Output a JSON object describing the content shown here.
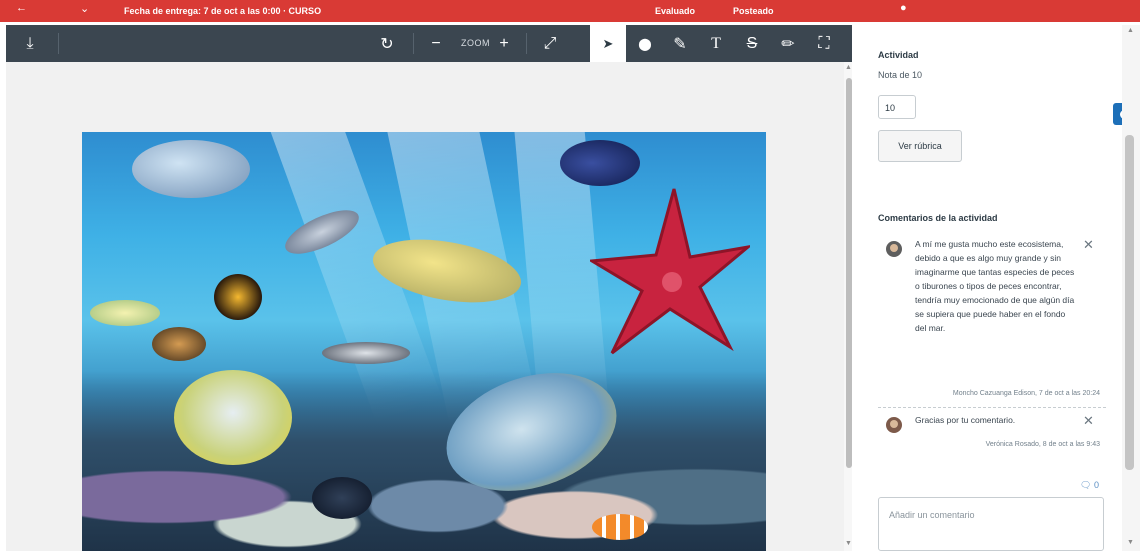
{
  "header": {
    "due_text": "Fecha de entrega: 7 de oct a las 0:00 · CURSO",
    "nav_left": "Evaluado",
    "nav_right": "Posteado",
    "back_icon": "arrow-left-icon",
    "user_icon": "user-icon"
  },
  "toolbar": {
    "zoom_label": "ZOOM",
    "tools": [
      "download-icon",
      "rotate-icon",
      "zoom-out-icon",
      "zoom-in-icon",
      "expand-icon",
      "pointer-icon",
      "pin-icon",
      "highlight-icon",
      "text-icon",
      "strikeout-icon",
      "pencil-icon",
      "area-select-icon"
    ],
    "active_tool": "pointer-icon",
    "symbols": {
      "download": "⤓",
      "rotate": "↻",
      "zoom_out": "−",
      "zoom_in": "+",
      "expand": "⤢",
      "pointer": "➤",
      "pin": "⬤",
      "highlight": "✎",
      "text": "T",
      "strike": "S",
      "pencil": "✏",
      "area": "⛶"
    }
  },
  "viewer": {
    "image_alt": "Acuario con peces tropicales y estrella de mar"
  },
  "panel": {
    "activity_heading": "Actividad",
    "grade_scale": "Nota de 10",
    "grade_value": "10",
    "rubric_button": "Ver rúbrica",
    "comments_heading": "Comentarios de la actividad",
    "comments": [
      {
        "text": "A mí me gusta mucho este ecosistema, debido a que es algo muy grande y sin imaginarme que tantas especies de peces o tiburones o tipos de peces encontrar, tendría muy emocionado de que algún día se supiera que puede haber en el fondo del mar.",
        "author_time": "Moncho Cazuanga Edison, 7 de oct a las 20:24",
        "close_symbol": "✕"
      },
      {
        "text": "Gracias por tu comentario.",
        "author_time": "Verónica Rosado, 8 de oct a las 9:43",
        "close_symbol": "✕"
      }
    ],
    "comment_count": "0",
    "comment_count_icon": "speech-bubble-icon",
    "comment_placeholder": "Añadir un comentario"
  },
  "colors": {
    "header_red": "#d93a35",
    "toolbar_bg": "#3b4650",
    "accent_blue": "#1d6fb8"
  }
}
